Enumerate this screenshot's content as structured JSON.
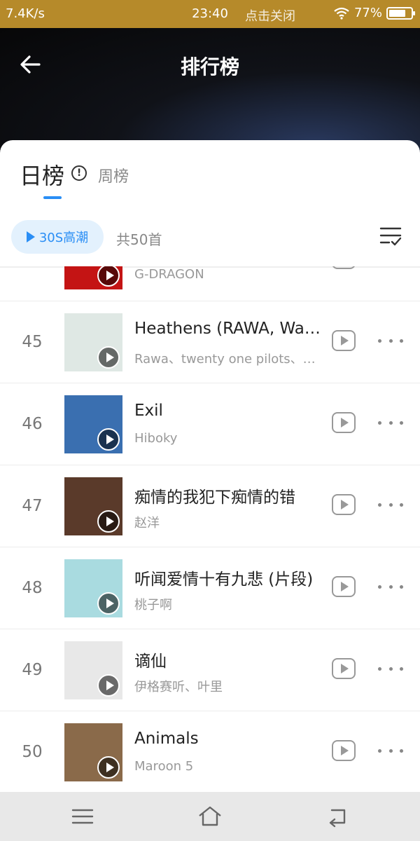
{
  "status_bar": {
    "left": "7.4K/s",
    "center": "23:40",
    "notice": "点击关闭",
    "battery": "77%",
    "battery_level": 0.77
  },
  "header": {
    "title": "排行榜"
  },
  "tabs": {
    "active": "日榜",
    "inactive": "周榜",
    "info_icon": "!"
  },
  "toolbar": {
    "play_label": "30S高潮",
    "count": "共50首"
  },
  "songs": [
    {
      "rank": "",
      "title": "",
      "artist": "G-DRAGON",
      "cover": "#c41414"
    },
    {
      "rank": "45",
      "title": "Heathens (RAWA, Wa…",
      "artist": "Rawa、twenty one pilots、…",
      "cover": "#dfe8e4"
    },
    {
      "rank": "46",
      "title": "Exil",
      "artist": "Hiboky",
      "cover": "#3a6fb0"
    },
    {
      "rank": "47",
      "title": "痴情的我犯下痴情的错",
      "artist": "赵洋",
      "cover": "#5a3a2a"
    },
    {
      "rank": "48",
      "title": "听闻爱情十有九悲 (片段)",
      "artist": "桃子啊",
      "cover": "#a9dbe0"
    },
    {
      "rank": "49",
      "title": "谪仙",
      "artist": "伊格赛听、叶里",
      "cover": "#e8e8e8"
    },
    {
      "rank": "50",
      "title": "Animals",
      "artist": "Maroon 5",
      "cover": "#8a6a4a"
    }
  ],
  "colors": {
    "accent": "#2a8ef5",
    "status_bar": "#b68a2a"
  }
}
